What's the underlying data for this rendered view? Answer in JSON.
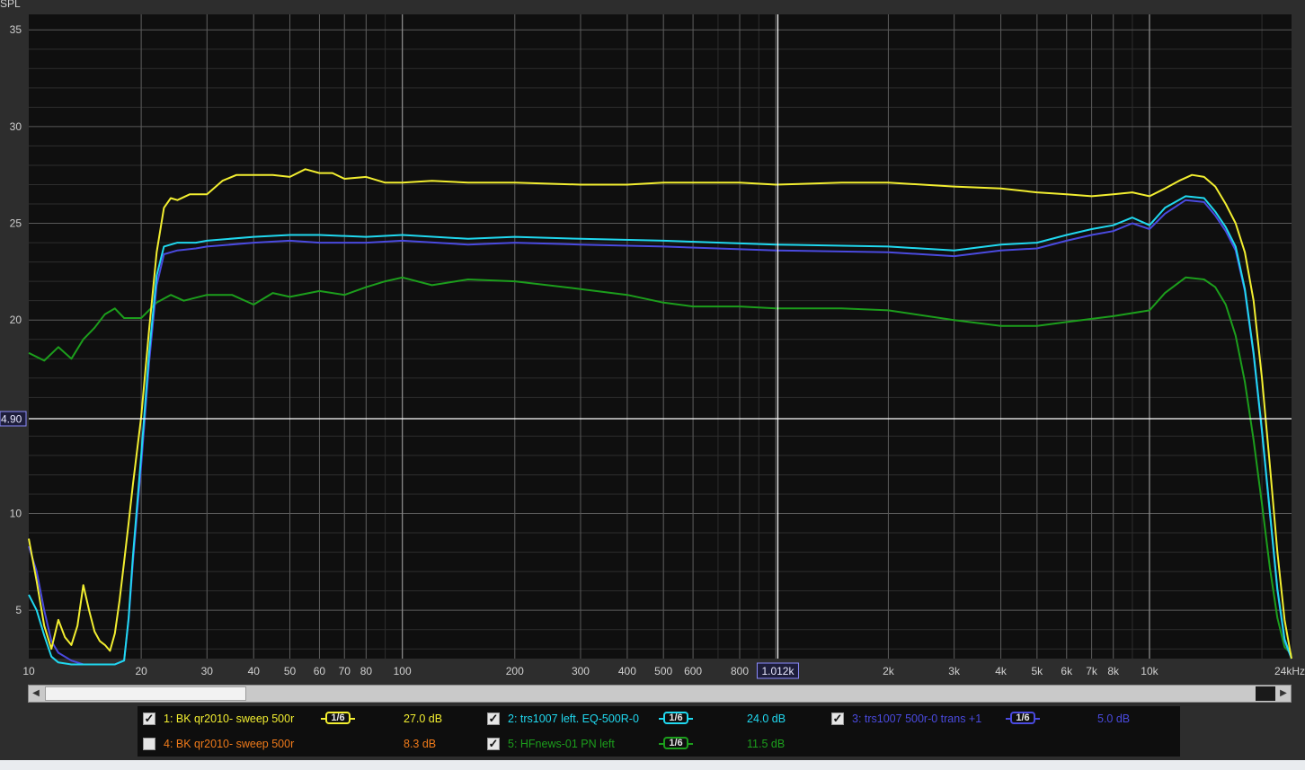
{
  "chart_data": {
    "type": "line",
    "ylabel": "SPL",
    "xlabel": "",
    "x_scale": "log",
    "xlim": [
      10,
      24000
    ],
    "ylim": [
      2.5,
      35.8
    ],
    "x_ticks": [
      {
        "v": 10,
        "label": "10"
      },
      {
        "v": 20,
        "label": "20"
      },
      {
        "v": 30,
        "label": "30"
      },
      {
        "v": 40,
        "label": "40"
      },
      {
        "v": 50,
        "label": "50"
      },
      {
        "v": 60,
        "label": "60"
      },
      {
        "v": 70,
        "label": "70"
      },
      {
        "v": 80,
        "label": "80"
      },
      {
        "v": 100,
        "label": "100"
      },
      {
        "v": 200,
        "label": "200"
      },
      {
        "v": 300,
        "label": "300"
      },
      {
        "v": 400,
        "label": "400"
      },
      {
        "v": 500,
        "label": "500"
      },
      {
        "v": 600,
        "label": "600"
      },
      {
        "v": 800,
        "label": "800"
      },
      {
        "v": 2000,
        "label": "2k"
      },
      {
        "v": 3000,
        "label": "3k"
      },
      {
        "v": 4000,
        "label": "4k"
      },
      {
        "v": 5000,
        "label": "5k"
      },
      {
        "v": 6000,
        "label": "6k"
      },
      {
        "v": 7000,
        "label": "7k"
      },
      {
        "v": 8000,
        "label": "8k"
      },
      {
        "v": 10000,
        "label": "10k"
      },
      {
        "v": 24000,
        "label": "24kHz"
      }
    ],
    "y_ticks": [
      {
        "v": 35,
        "label": "35"
      },
      {
        "v": 30,
        "label": "30"
      },
      {
        "v": 25,
        "label": "25"
      },
      {
        "v": 20,
        "label": "20"
      },
      {
        "v": 10,
        "label": "10"
      },
      {
        "v": 5,
        "label": "5"
      }
    ],
    "cursor": {
      "x": 1012,
      "x_label": "1.012k",
      "y": 14.9,
      "y_label": "4.90"
    },
    "grid": true,
    "series": [
      {
        "name": "5: HFnews-01 PN left",
        "color": "#1c9e1c",
        "x": [
          10,
          11,
          12,
          13,
          14,
          15,
          16,
          17,
          18,
          20,
          22,
          24,
          26,
          30,
          35,
          40,
          45,
          50,
          60,
          70,
          80,
          90,
          100,
          120,
          150,
          200,
          300,
          400,
          500,
          600,
          800,
          1000,
          1500,
          2000,
          3000,
          4000,
          5000,
          6000,
          8000,
          10000,
          11000,
          12500,
          14000,
          15000,
          16000,
          17000,
          18000,
          19000,
          20000,
          21000,
          22000,
          23000,
          24000
        ],
        "y": [
          18.3,
          17.9,
          18.6,
          18.0,
          19.0,
          19.6,
          20.3,
          20.6,
          20.1,
          20.1,
          20.9,
          21.3,
          21.0,
          21.3,
          21.3,
          20.8,
          21.4,
          21.2,
          21.5,
          21.3,
          21.7,
          22.0,
          22.2,
          21.8,
          22.1,
          22.0,
          21.6,
          21.3,
          20.9,
          20.7,
          20.7,
          20.6,
          20.6,
          20.5,
          20.0,
          19.7,
          19.7,
          19.9,
          20.2,
          20.5,
          21.4,
          22.2,
          22.1,
          21.7,
          20.8,
          19.2,
          16.8,
          13.8,
          10.5,
          7.2,
          4.6,
          3.1,
          2.7
        ]
      },
      {
        "name": "3: trs1007 500r-0 trans +1",
        "color": "#4a4adf",
        "x": [
          10,
          10.5,
          11,
          11.5,
          12,
          13,
          14,
          15,
          16,
          17,
          18,
          18.5,
          19,
          20,
          21,
          22,
          23,
          25,
          28,
          30,
          40,
          50,
          60,
          80,
          100,
          150,
          200,
          300,
          500,
          1000,
          2000,
          3000,
          4000,
          5000,
          6000,
          7000,
          8000,
          9000,
          10000,
          11000,
          12500,
          14000,
          15000,
          16000,
          17000,
          18000,
          19000,
          20000,
          21000,
          22000,
          23000,
          24000
        ],
        "y": [
          8.3,
          7.0,
          5.0,
          3.4,
          2.8,
          2.4,
          2.2,
          2.2,
          2.2,
          2.2,
          2.4,
          4.5,
          7.5,
          12.5,
          17.8,
          21.8,
          23.4,
          23.6,
          23.7,
          23.8,
          24.0,
          24.1,
          24.0,
          24.0,
          24.1,
          23.9,
          24.0,
          23.9,
          23.8,
          23.6,
          23.5,
          23.3,
          23.6,
          23.7,
          24.1,
          24.4,
          24.6,
          25.0,
          24.7,
          25.5,
          26.2,
          26.1,
          25.4,
          24.6,
          23.6,
          21.5,
          18.2,
          14.2,
          10.0,
          6.0,
          3.4,
          2.5
        ]
      },
      {
        "name": "2: trs1007 left. EQ-500R-0",
        "color": "#20d8ef",
        "x": [
          10,
          10.5,
          11,
          11.5,
          12,
          13,
          14,
          15,
          16,
          17,
          18,
          18.5,
          19,
          20,
          21,
          22,
          23,
          25,
          28,
          30,
          40,
          50,
          60,
          80,
          100,
          150,
          200,
          300,
          500,
          1000,
          2000,
          3000,
          4000,
          5000,
          6000,
          7000,
          8000,
          9000,
          10000,
          11000,
          12500,
          14000,
          15000,
          16000,
          17000,
          18000,
          19000,
          20000,
          21000,
          22000,
          23000,
          24000
        ],
        "y": [
          5.8,
          5.0,
          3.7,
          2.6,
          2.3,
          2.2,
          2.2,
          2.2,
          2.2,
          2.2,
          2.4,
          4.6,
          7.8,
          13.0,
          18.3,
          22.3,
          23.8,
          24.0,
          24.0,
          24.1,
          24.3,
          24.4,
          24.4,
          24.3,
          24.4,
          24.2,
          24.3,
          24.2,
          24.1,
          23.9,
          23.8,
          23.6,
          23.9,
          24.0,
          24.4,
          24.7,
          24.9,
          25.3,
          24.9,
          25.8,
          26.4,
          26.3,
          25.6,
          24.8,
          23.8,
          21.6,
          18.3,
          14.3,
          10.1,
          6.1,
          3.5,
          2.5
        ]
      },
      {
        "name": "1: BK qr2010- sweep 500r",
        "color": "#f2ee30",
        "x": [
          10,
          10.5,
          11,
          11.5,
          12,
          12.5,
          13,
          13.5,
          14,
          14.5,
          15,
          15.5,
          16,
          16.5,
          17,
          17.5,
          18,
          18.5,
          19,
          20,
          21,
          22,
          23,
          24,
          25,
          27,
          30,
          33,
          36,
          40,
          45,
          50,
          55,
          60,
          65,
          70,
          80,
          90,
          100,
          120,
          150,
          200,
          300,
          400,
          500,
          600,
          800,
          1000,
          1500,
          2000,
          3000,
          4000,
          5000,
          6000,
          7000,
          8000,
          9000,
          10000,
          11000,
          12000,
          13000,
          14000,
          15000,
          16000,
          17000,
          18000,
          19000,
          20000,
          21000,
          22000,
          23000,
          24000
        ],
        "y": [
          8.7,
          6.5,
          4.2,
          3.0,
          4.5,
          3.6,
          3.2,
          4.2,
          6.3,
          5.0,
          3.9,
          3.4,
          3.2,
          2.9,
          3.8,
          5.5,
          7.5,
          9.5,
          11.5,
          15.0,
          19.5,
          23.5,
          25.8,
          26.3,
          26.2,
          26.5,
          26.5,
          27.2,
          27.5,
          27.5,
          27.5,
          27.4,
          27.8,
          27.6,
          27.6,
          27.3,
          27.4,
          27.1,
          27.1,
          27.2,
          27.1,
          27.1,
          27.0,
          27.0,
          27.1,
          27.1,
          27.1,
          27.0,
          27.1,
          27.1,
          26.9,
          26.8,
          26.6,
          26.5,
          26.4,
          26.5,
          26.6,
          26.4,
          26.8,
          27.2,
          27.5,
          27.4,
          26.9,
          26.0,
          25.0,
          23.5,
          21.0,
          17.0,
          12.5,
          8.0,
          4.5,
          2.5
        ]
      }
    ]
  },
  "legend": {
    "rows": [
      [
        {
          "checked": true,
          "name": "1: BK qr2010- sweep 500r",
          "smoothing": "1/6",
          "value": "27.0 dB",
          "color": "#f2ee30"
        },
        {
          "checked": true,
          "name": "2: trs1007 left. EQ-500R-0",
          "smoothing": "1/6",
          "value": "24.0 dB",
          "color": "#20d8ef"
        },
        {
          "checked": true,
          "name": "3: trs1007 500r-0 trans +1",
          "smoothing": "1/6",
          "value": "5.0 dB",
          "color": "#4a4adf"
        }
      ],
      [
        {
          "checked": false,
          "name": "4: BK qr2010- sweep 500r",
          "smoothing": "",
          "value": "8.3 dB",
          "color": "#ef7a1a"
        },
        {
          "checked": true,
          "name": "5: HFnews-01 PN left",
          "smoothing": "1/6",
          "value": "11.5 dB",
          "color": "#1c9e1c"
        }
      ]
    ]
  },
  "colors": {
    "plot_bg": "#0f0f0f",
    "frame": "#2d2d2d",
    "grid_major": "#5a5a5a",
    "grid_minor": "#2e2e2e",
    "cursor": "#ffffff"
  },
  "icons": {
    "check": "check-mark-icon",
    "scroll_left": "arrow-left-icon",
    "scroll_right": "arrow-right-icon"
  }
}
